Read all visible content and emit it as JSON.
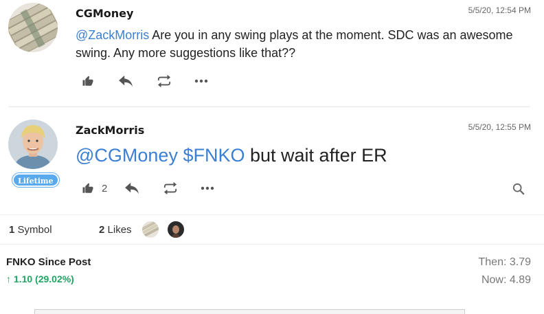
{
  "posts": [
    {
      "username": "CGMoney",
      "timestamp": "5/5/20, 12:54 PM",
      "mention": "@ZackMorris",
      "text_line1": " Are you in any swing plays at the moment.  SDC was an awesome",
      "text_line2": "swing.  Any more suggestions like that??",
      "avatar": "money-stack-avatar"
    },
    {
      "username": "ZackMorris",
      "timestamp": "5/5/20, 12:55 PM",
      "mention1": "@CGMoney",
      "mention2": "$FNKO",
      "text": " but wait after ER",
      "badge": "Lifetime",
      "like_count": "2",
      "avatar": "person-avatar"
    }
  ],
  "stats": {
    "symbols_count": "1",
    "symbols_label": "Symbol",
    "likes_count": "2",
    "likes_label": "Likes"
  },
  "performance": {
    "title": "FNKO Since Post",
    "change": "↑ 1.10 (29.02%)",
    "then": "Then: 3.79",
    "now": "Now: 4.89",
    "up_color": "#21a363"
  },
  "colors": {
    "accent": "#3b7fd2",
    "badge": "#59a9ee"
  }
}
